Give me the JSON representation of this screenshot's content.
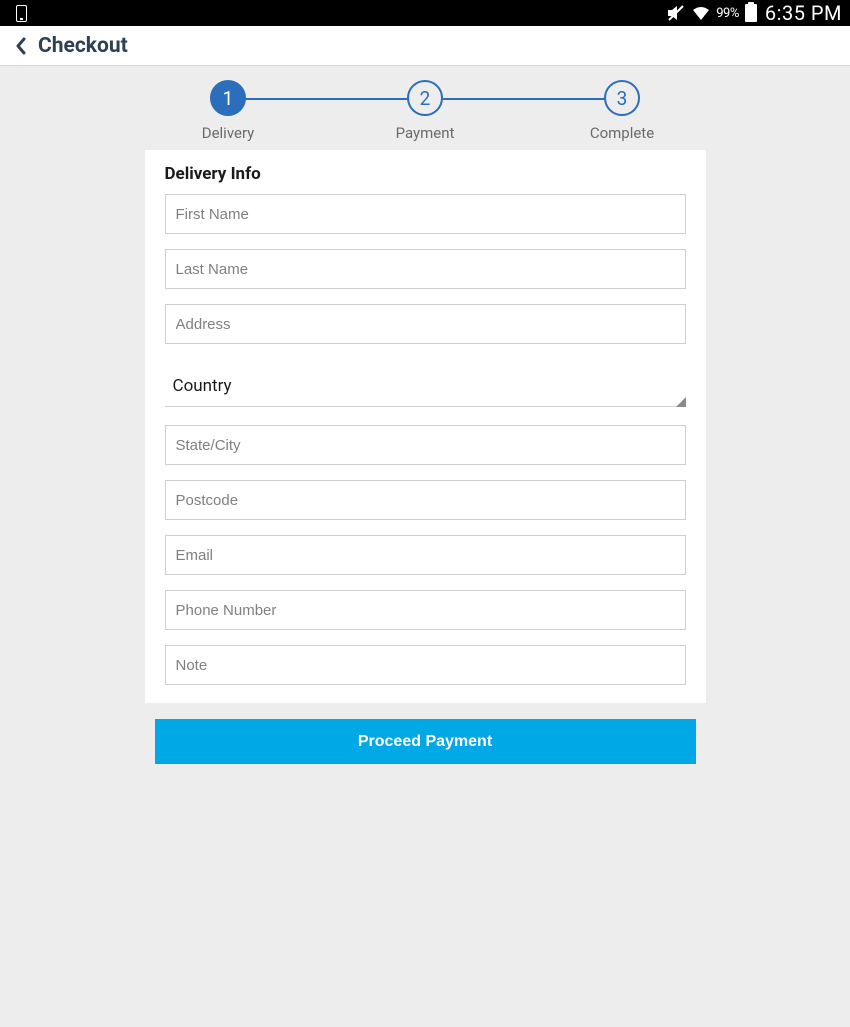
{
  "status_bar": {
    "battery_pct": "99%",
    "clock": "6:35 PM"
  },
  "app_bar": {
    "title": "Checkout"
  },
  "stepper": {
    "steps": [
      {
        "num": "1",
        "label": "Delivery",
        "active": true
      },
      {
        "num": "2",
        "label": "Payment",
        "active": false
      },
      {
        "num": "3",
        "label": "Complete",
        "active": false
      }
    ]
  },
  "form": {
    "section_title": "Delivery Info",
    "fields": {
      "first_name_ph": "First Name",
      "last_name_ph": "Last Name",
      "address_ph": "Address",
      "country_label": "Country",
      "state_city_ph": "State/City",
      "postcode_ph": "Postcode",
      "email_ph": "Email",
      "phone_ph": "Phone Number",
      "note_ph": "Note"
    }
  },
  "proceed_label": "Proceed Payment"
}
